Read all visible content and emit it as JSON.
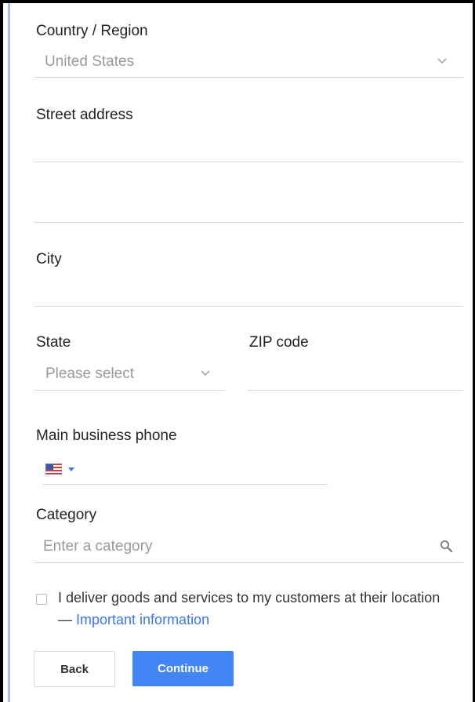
{
  "form": {
    "country": {
      "label": "Country / Region",
      "value": "United States"
    },
    "street": {
      "label": "Street address",
      "value_line1": "",
      "value_line2": ""
    },
    "city": {
      "label": "City",
      "value": ""
    },
    "state": {
      "label": "State",
      "placeholder": "Please select"
    },
    "zip": {
      "label": "ZIP code",
      "value": ""
    },
    "phone": {
      "label": "Main business phone",
      "country_flag": "us-flag-icon",
      "value": ""
    },
    "category": {
      "label": "Category",
      "placeholder": "Enter a category",
      "icon": "search-icon"
    },
    "delivery": {
      "checked": false,
      "text": "I deliver goods and services to my customers at their location — ",
      "link_text": "Important information"
    }
  },
  "actions": {
    "back_label": "Back",
    "continue_label": "Continue"
  },
  "colors": {
    "accent_blue": "#4285f4",
    "link_blue": "#3b78e7",
    "side_bar": "#aac1ea",
    "divider": "#d6d6d6"
  }
}
